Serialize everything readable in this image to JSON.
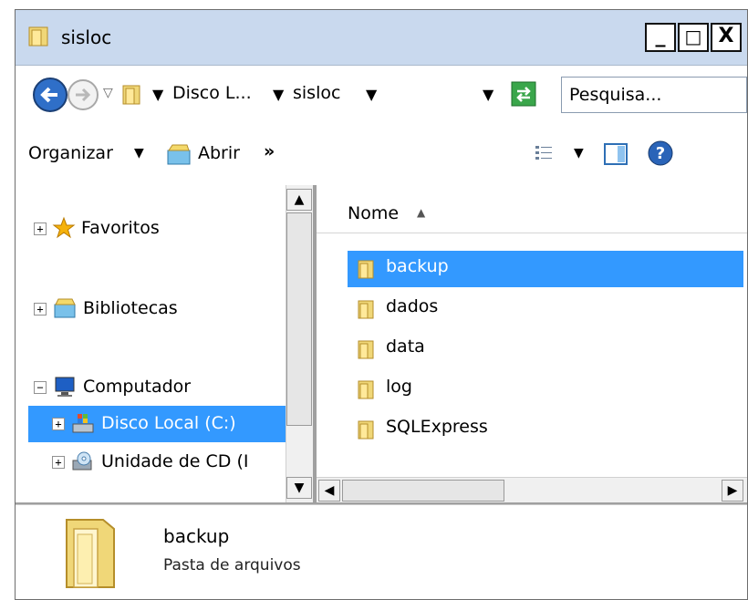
{
  "window": {
    "title": "sisloc",
    "min_label": "_",
    "max_label": "□",
    "close_label": "X"
  },
  "address": {
    "crumbs": [
      "Disco L...",
      "sisloc"
    ],
    "search_placeholder": "Pesquisa..."
  },
  "toolbar": {
    "organize": "Organizar",
    "open": "Abrir",
    "more": "»"
  },
  "nav": {
    "items": [
      {
        "label": "Favoritos",
        "icon": "star-icon",
        "expander": "+"
      },
      {
        "label": "Bibliotecas",
        "icon": "libraries-icon",
        "expander": "+"
      },
      {
        "label": "Computador",
        "icon": "computer-icon",
        "expander": "−"
      },
      {
        "label": "Disco Local (C:)",
        "icon": "drive-icon",
        "expander": "+"
      },
      {
        "label": "Unidade de CD (I",
        "icon": "cd-drive-icon",
        "expander": "+"
      }
    ]
  },
  "content": {
    "column_header": "Nome",
    "files": [
      {
        "name": "backup"
      },
      {
        "name": "dados"
      },
      {
        "name": "data"
      },
      {
        "name": "log"
      },
      {
        "name": "SQLExpress"
      }
    ]
  },
  "details": {
    "name": "backup",
    "type": "Pasta de arquivos"
  },
  "colors": {
    "selection": "#3399ff",
    "titlebar": "#c9d9ee",
    "folder": "#e8c45a"
  }
}
